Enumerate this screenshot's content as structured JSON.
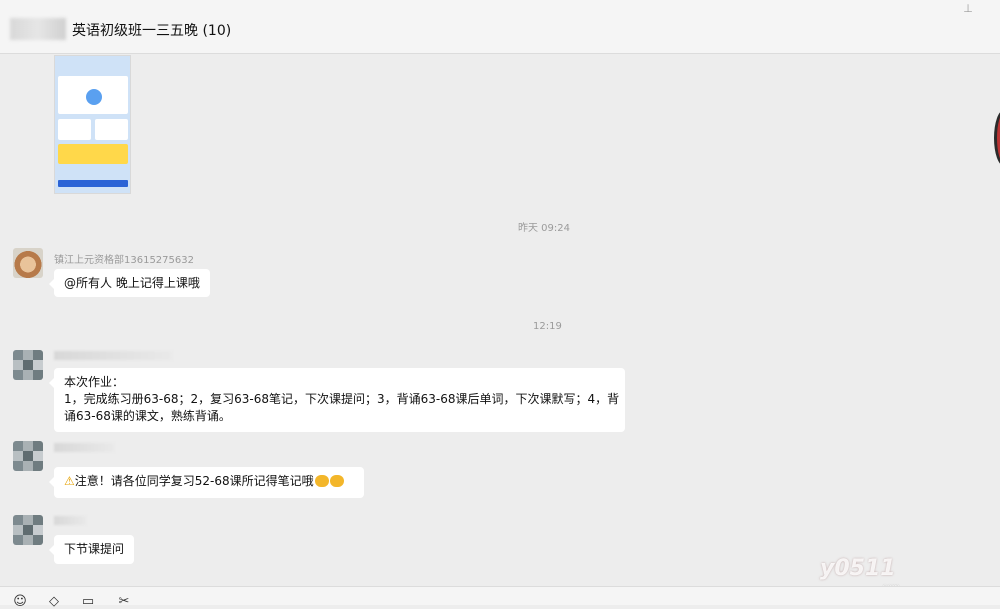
{
  "header": {
    "title": "英语初级班一三五晚 (10)"
  },
  "messages": {
    "timestamp_1": "昨天 09:24",
    "msg1": {
      "sender": "镇江上元资格部13615275632",
      "text": "@所有人 晚上记得上课哦"
    },
    "timestamp_2": "12:19",
    "msg2": {
      "lines": [
        "本次作业：",
        "1，完成练习册63-68；2，复习63-68笔记，下次课提问；3，背诵63-68课后单词，下次课默写；4，背",
        "诵63-68课的课文，熟练背诵。"
      ]
    },
    "msg3": {
      "text": "注意！请各位同学复习52-68课所记得笔记哦"
    },
    "msg4": {
      "text": "下节课提问"
    }
  },
  "watermark": {
    "main": "y0511",
    "sub": ".com"
  },
  "icons": {
    "pin": "pin-icon",
    "emoji": "emoji-icon",
    "favorite": "favorite-icon",
    "folder": "folder-icon",
    "scissors": "scissors-icon"
  },
  "colors": {
    "background": "#ededed",
    "bubble": "#ffffff",
    "timestamp": "#9b9b9b"
  }
}
